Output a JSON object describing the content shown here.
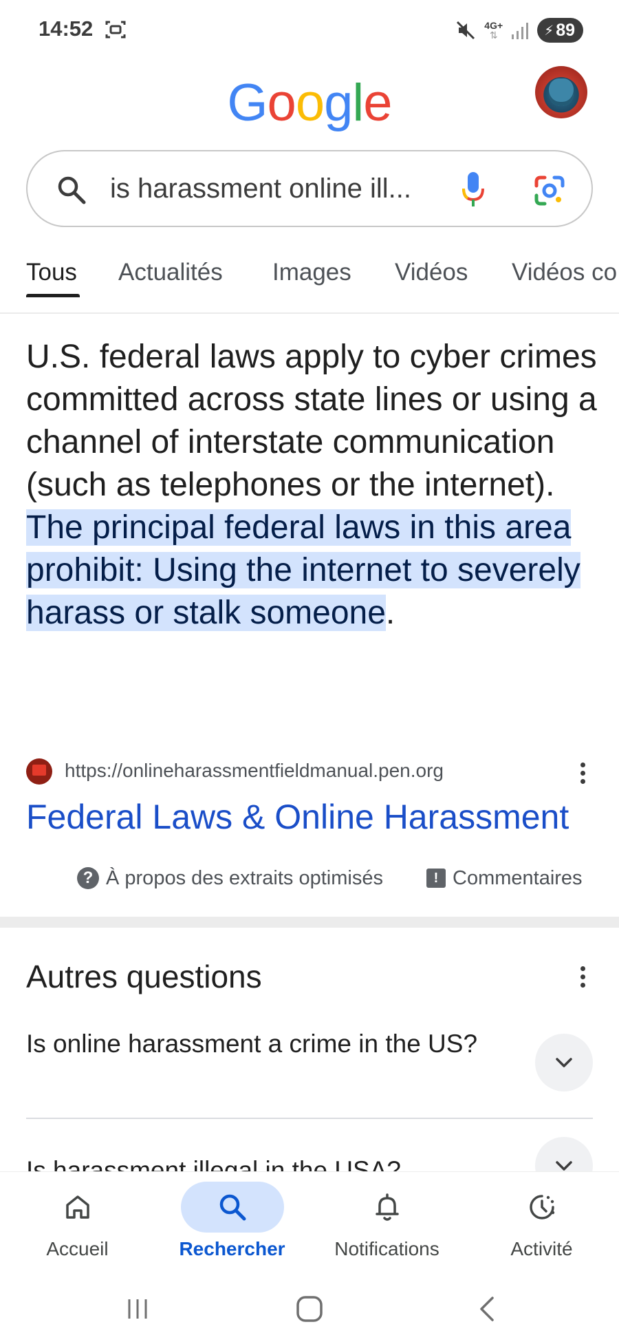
{
  "status_bar": {
    "time": "14:52",
    "network": "4G+",
    "battery": "89",
    "icons": [
      "screen-record-icon",
      "mute-icon",
      "network-icon",
      "signal-icon",
      "battery-icon"
    ]
  },
  "header": {
    "logo": "Google",
    "logo_colors": [
      "#4285F4",
      "#EA4335",
      "#FBBC05",
      "#4285F4",
      "#34A853",
      "#EA4335"
    ]
  },
  "search": {
    "query": "is harassment online ill...",
    "icons": [
      "search-icon",
      "mic-icon",
      "google-lens-icon"
    ]
  },
  "tabs": [
    {
      "label": "Tous",
      "active": true
    },
    {
      "label": "Actualités",
      "active": false
    },
    {
      "label": "Images",
      "active": false
    },
    {
      "label": "Vidéos",
      "active": false
    },
    {
      "label": "Vidéos co",
      "active": false
    }
  ],
  "featured_snippet": {
    "text_plain": "U.S. federal laws apply to cyber crimes committed across state lines or using a channel of interstate communication (such as telephones or the internet). ",
    "text_highlight": "The principal federal laws in this area prohibit:  Using the internet to severely harass or stalk someone",
    "text_end": ".",
    "source_url": "https://onlineharassmentfieldmanual.pen.org",
    "title": "Federal Laws & Online Harassment",
    "about_label": "À propos des extraits optimisés",
    "feedback_label": "Commentaires",
    "highlight_color": "#d3e3fd",
    "link_color": "#1a4ec8"
  },
  "people_also_ask": {
    "title": "Autres questions",
    "questions": [
      "Is online harassment a crime in the US?",
      "Is harassment illegal in the USA?"
    ]
  },
  "bottom_nav": [
    {
      "label": "Accueil",
      "icon": "home-icon",
      "active": false
    },
    {
      "label": "Rechercher",
      "icon": "search-icon",
      "active": true
    },
    {
      "label": "Notifications",
      "icon": "bell-icon",
      "active": false
    },
    {
      "label": "Activité",
      "icon": "activity-icon",
      "active": false
    }
  ],
  "system_nav": [
    "recent-apps-icon",
    "home-button-icon",
    "back-icon"
  ]
}
